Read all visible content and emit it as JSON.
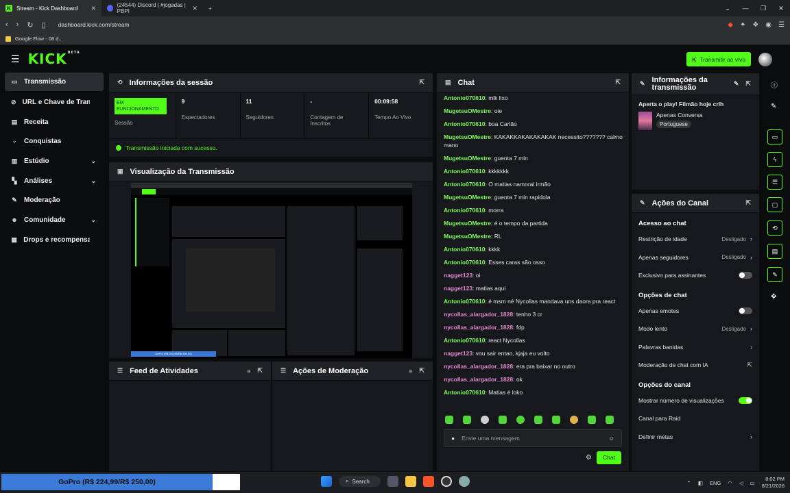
{
  "browser": {
    "tabs": [
      {
        "title": "Stream - Kick Dashboard",
        "active": true
      },
      {
        "title": "(24544) Discord | #jogadas | PBPI",
        "active": false
      }
    ],
    "url": "dashboard.kick.com/stream",
    "bookmark": "Google Flow - 08 d..."
  },
  "header": {
    "logo": "KICK",
    "logo_badge": "BETA",
    "go_live": "Transmitir ao vivo"
  },
  "sidebar": {
    "items": [
      {
        "label": "Transmissão",
        "icon": "broadcast-icon",
        "glyph": "▭",
        "chev": ""
      },
      {
        "label": "URL e Chave de Transmissão",
        "icon": "link-icon",
        "glyph": "⊘",
        "chev": ""
      },
      {
        "label": "Receita",
        "icon": "revenue-icon",
        "glyph": "▤",
        "chev": ""
      },
      {
        "label": "Conquistas",
        "icon": "trophy-icon",
        "glyph": "♆",
        "chev": ""
      },
      {
        "label": "Estúdio",
        "icon": "studio-icon",
        "glyph": "▥",
        "chev": "⌄"
      },
      {
        "label": "Análises",
        "icon": "analytics-icon",
        "glyph": "▚",
        "chev": "⌄"
      },
      {
        "label": "Moderação",
        "icon": "wrench-icon",
        "glyph": "✎",
        "chev": ""
      },
      {
        "label": "Comunidade",
        "icon": "community-icon",
        "glyph": "☻",
        "chev": "⌄"
      },
      {
        "label": "Drops e recompensas",
        "icon": "drops-icon",
        "glyph": "▦",
        "chev": ""
      }
    ]
  },
  "session": {
    "title": "Informações da sessão",
    "status_badge": "EM FUNCIONAMENTO",
    "stats": [
      {
        "value": "",
        "label": "Sessão"
      },
      {
        "value": "9",
        "label": "Espectadores"
      },
      {
        "value": "11",
        "label": "Seguidores"
      },
      {
        "value": "-",
        "label": "Contagem de Inscritos"
      },
      {
        "value": "00:09:58",
        "label": "Tempo Ao Vivo"
      }
    ],
    "success": "Transmissão iniciada com sucesso."
  },
  "preview": {
    "title": "Visualização da Transmissão",
    "strip": "GoPro (R$ 224,99/R$ 250,00)"
  },
  "feed": {
    "title": "Feed de Atividades"
  },
  "moderation": {
    "title": "Ações de Moderação"
  },
  "chat": {
    "title": "Chat",
    "messages": [
      {
        "user": "Antonio070610",
        "kind": "a",
        "text": "mlk lixo"
      },
      {
        "user": "MugetsuOMestre",
        "kind": "m",
        "text": "oie"
      },
      {
        "user": "Antonio070610",
        "kind": "a",
        "text": "boa Carlão"
      },
      {
        "user": "MugetsuOMestre",
        "kind": "m",
        "text": "KAKAKKAKAKAKAKAK necessito??????? calmo mano"
      },
      {
        "user": "MugetsuOMestre",
        "kind": "m",
        "text": "guenta 7 min"
      },
      {
        "user": "Antonio070610",
        "kind": "a",
        "text": "kkkkkkk"
      },
      {
        "user": "Antonio070610",
        "kind": "a",
        "text": "O matias namoral irmão"
      },
      {
        "user": "MugetsuOMestre",
        "kind": "m",
        "text": "guenta 7 min rapidola"
      },
      {
        "user": "Antonio070610",
        "kind": "a",
        "text": "morra"
      },
      {
        "user": "MugetsuOMestre",
        "kind": "m",
        "text": "é o tempo da partida"
      },
      {
        "user": "MugetsuOMestre",
        "kind": "m",
        "text": "RL"
      },
      {
        "user": "Antonio070610",
        "kind": "a",
        "text": "kkkk"
      },
      {
        "user": "Antonio070610",
        "kind": "a",
        "text": "Esses caras são osso"
      },
      {
        "user": "nagget123",
        "kind": "n",
        "text": "oi"
      },
      {
        "user": "nagget123",
        "kind": "n",
        "text": "matias aqui"
      },
      {
        "user": "Antonio070610",
        "kind": "a",
        "text": "é msm né Nycollas mandava uns daora pra react"
      },
      {
        "user": "nycollas_alargador_1828",
        "kind": "n",
        "text": "tenho 3 cr"
      },
      {
        "user": "nycollas_alargador_1828",
        "kind": "n",
        "text": "fdp"
      },
      {
        "user": "Antonio070610",
        "kind": "a",
        "text": "react Nycollas"
      },
      {
        "user": "nagget123",
        "kind": "n",
        "text": "vou sair entao, kjaja eu volto"
      },
      {
        "user": "nycollas_alargador_1828",
        "kind": "n",
        "text": "era pra baixar no outro"
      },
      {
        "user": "nycollas_alargador_1828",
        "kind": "n",
        "text": "ok"
      },
      {
        "user": "Antonio070610",
        "kind": "a",
        "text": "Matias é loko"
      }
    ],
    "input_placeholder": "Envie uma mensagem",
    "send": "Chat"
  },
  "info": {
    "title": "Informações da transmissão",
    "stream_title": "Aperta o play! Filmão hoje crlh",
    "category": "Apenas Conversa",
    "language": "Portuguese"
  },
  "actions": {
    "title": "Ações do Canal",
    "sections": [
      {
        "title": "Acesso ao chat",
        "rows": [
          {
            "label": "Restrição de idade",
            "value": "Desligado",
            "type": "select"
          },
          {
            "label": "Apenas seguidores",
            "value": "Desligado",
            "type": "select"
          },
          {
            "label": "Exclusivo para assinantes",
            "value": "",
            "type": "toggle-off"
          }
        ]
      },
      {
        "title": "Opções de chat",
        "rows": [
          {
            "label": "Apenas emotes",
            "value": "",
            "type": "toggle-off"
          },
          {
            "label": "Modo lento",
            "value": "Desligado",
            "type": "select"
          },
          {
            "label": "Palavras banidas",
            "value": "",
            "type": "select"
          },
          {
            "label": "Moderação de chat com IA",
            "value": "",
            "type": "external"
          }
        ]
      },
      {
        "title": "Opções do canal",
        "rows": [
          {
            "label": "Mostrar número de visualizações",
            "value": "",
            "type": "toggle-on"
          },
          {
            "label": "Canal para Raid",
            "value": "",
            "type": "none"
          },
          {
            "label": "Definir metas",
            "value": "",
            "type": "select"
          }
        ]
      }
    ]
  },
  "taskbar": {
    "gopro": "GoPro (R$ 224,99/R$ 250,00)",
    "search": "Search",
    "lang": "ENG",
    "time": "8:02 PM",
    "date": "8/21/2026"
  }
}
